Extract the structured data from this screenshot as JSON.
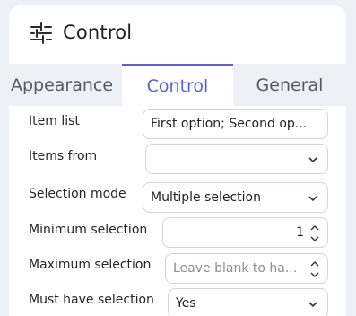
{
  "header": {
    "title": "Control",
    "icon": "sliders-icon"
  },
  "tabs": [
    {
      "label": "Appearance",
      "active": false
    },
    {
      "label": "Control",
      "active": true
    },
    {
      "label": "General",
      "active": false
    }
  ],
  "fields": {
    "item_list": {
      "label": "Item list",
      "value": "First option; Second op..."
    },
    "items_from": {
      "label": "Items from",
      "value": ""
    },
    "selection_mode": {
      "label": "Selection mode",
      "value": "Multiple selection"
    },
    "minimum_selection": {
      "label": "Minimum selection",
      "value": "1"
    },
    "maximum_selection": {
      "label": "Maximum selection",
      "placeholder": "Leave blank to ha..."
    },
    "must_have_selection": {
      "label": "Must have selection",
      "value": "Yes"
    }
  },
  "colors": {
    "accent": "#5b5fd6",
    "tab_bar": "#eef0f7",
    "panel": "#ffffff"
  }
}
